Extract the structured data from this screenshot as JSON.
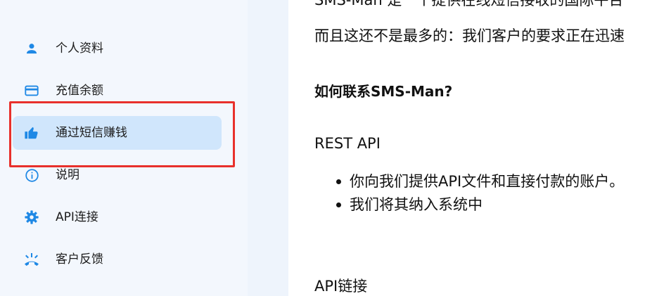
{
  "colors": {
    "accent": "#1e88e5",
    "sidebar_bg": "#f3f7fd",
    "active_bg": "#d0e6fc",
    "highlight": "#e8302b"
  },
  "sidebar": {
    "items": [
      {
        "label": "个人资料",
        "icon": "person-icon"
      },
      {
        "label": "充值余额",
        "icon": "credit-card-icon"
      },
      {
        "label": "通过短信赚钱",
        "icon": "thumbs-up-icon",
        "active": true
      },
      {
        "label": "说明",
        "icon": "info-icon"
      },
      {
        "label": "API连接",
        "icon": "gear-icon"
      },
      {
        "label": "客户反馈",
        "icon": "phone-callback-icon"
      }
    ]
  },
  "content": {
    "top_line": "SMS-Man 是一个提供在线短信接收的国际平台",
    "intro": "而且这还不是最多的：我们客户的要求正在迅速",
    "heading": "如何联系SMS-Man?",
    "method_label": "REST API",
    "bullets": [
      "你向我们提供API文件和直接付款的账户。",
      "我们将其纳入系统中"
    ],
    "api_link": "API链接"
  }
}
